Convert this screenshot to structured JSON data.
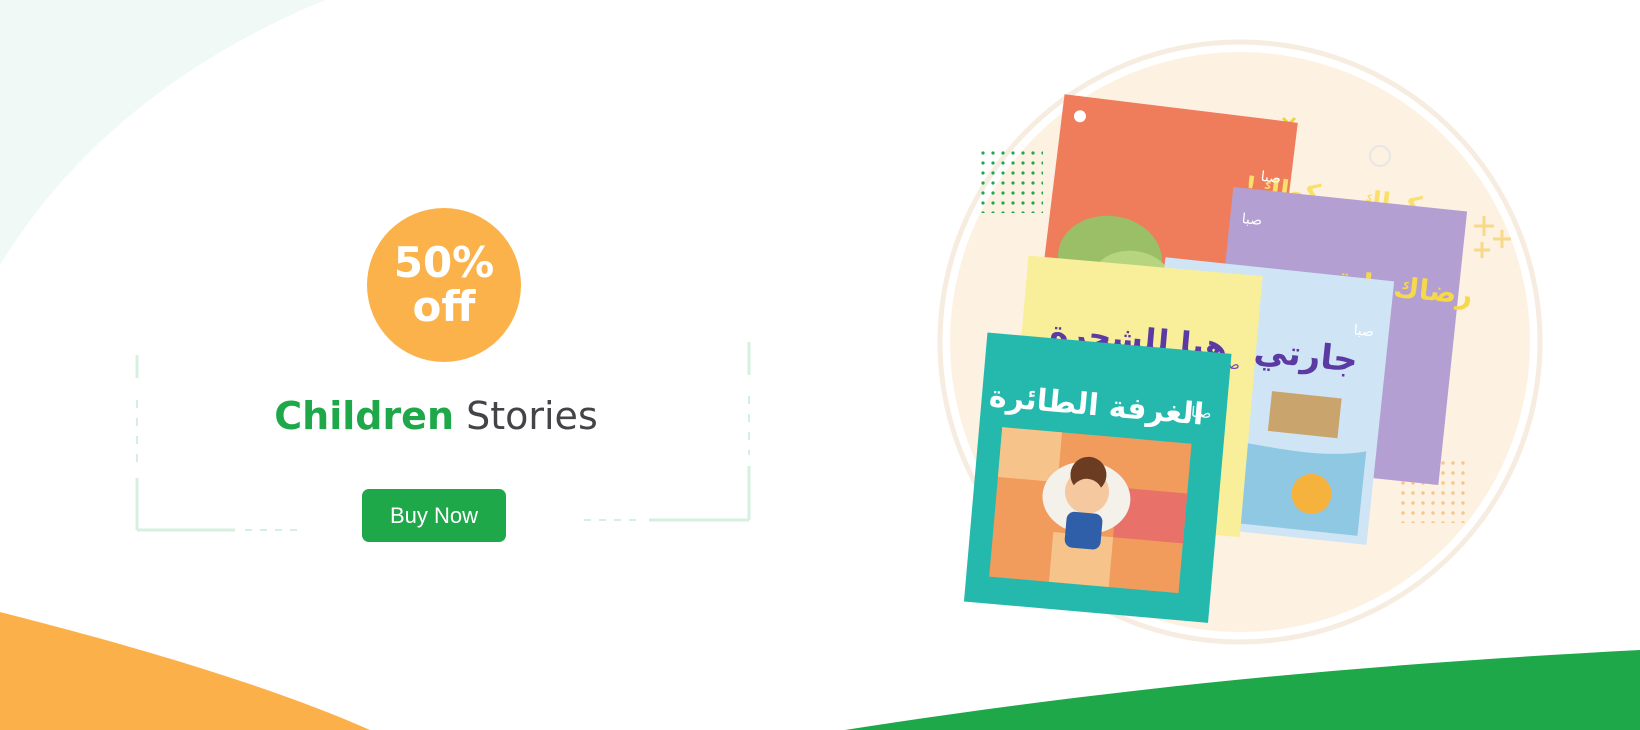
{
  "promo": {
    "discount_value": "50%",
    "discount_suffix": "off",
    "heading_accent": "Children",
    "heading_rest": "Stories",
    "cta_label": "Buy Now"
  },
  "books": [
    {
      "title": "كواك .. كواك!",
      "series": "صبا"
    },
    {
      "title": "رضاك يا قمر",
      "series": "صبا"
    },
    {
      "title": "جارتي",
      "series": "صبا"
    },
    {
      "title": "هيا للشجرة",
      "series": "صبا"
    },
    {
      "title": "الغرفة الطائرة",
      "series": "صبا"
    }
  ],
  "colors": {
    "brand_green": "#1ea84a",
    "badge_orange": "#fbb24b",
    "corner_orange": "#fbb04a"
  },
  "icons": [
    "plus-icon",
    "circle-outline-icon",
    "dot-grid-icon"
  ]
}
